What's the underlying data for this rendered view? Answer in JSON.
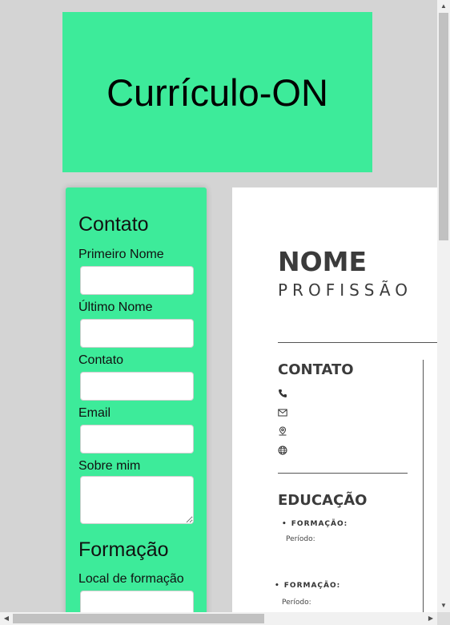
{
  "banner": {
    "title": "Currículo-ON"
  },
  "form": {
    "contact_heading": "Contato",
    "fields": [
      {
        "label": "Primeiro Nome",
        "value": ""
      },
      {
        "label": "Último Nome",
        "value": ""
      },
      {
        "label": "Contato",
        "value": ""
      },
      {
        "label": "Email",
        "value": ""
      },
      {
        "label": "Sobre mim",
        "value": ""
      }
    ],
    "education_heading": "Formação",
    "education_fields": [
      {
        "label": "Local de formação",
        "value": ""
      }
    ]
  },
  "resume": {
    "name": "NOME",
    "profession": "PROFISSÃO",
    "contact_heading": "CONTATO",
    "contact_icons": [
      "phone-icon",
      "mail-icon",
      "location-pin-icon",
      "globe-icon"
    ],
    "education_heading": "EDUCAÇÃO",
    "education_items": [
      {
        "title": "FORMAÇÃO:",
        "period": "Período:"
      },
      {
        "title": "FORMAÇÃO:",
        "period": "Período:"
      }
    ]
  },
  "colors": {
    "accent": "#3deb9a",
    "page_bg": "#d4d4d4",
    "resume_text": "#3b3b3b"
  }
}
